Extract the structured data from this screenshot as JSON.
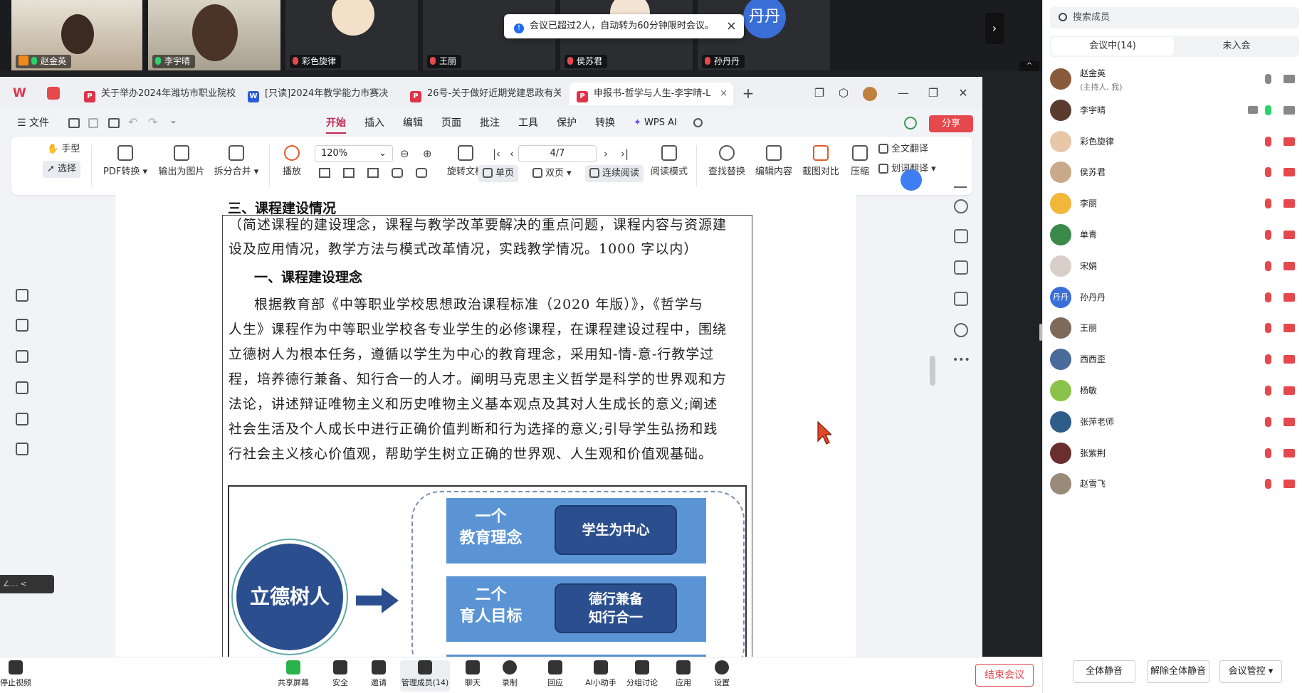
{
  "video_strip": {
    "tiles": [
      {
        "name": "赵金英",
        "mic": "on",
        "host": true
      },
      {
        "name": "李宇晴",
        "mic": "on",
        "host": false
      },
      {
        "name": "彩色旋律",
        "mic": "off",
        "host": false
      },
      {
        "name": "王丽",
        "mic": "off",
        "host": false
      },
      {
        "name": "侯苏君",
        "mic": "off",
        "host": false
      },
      {
        "name": "孙丹丹",
        "mic": "off",
        "host": false,
        "avatar_text": "丹丹"
      }
    ],
    "toast": "会议已超过2人，自动转为60分钟限时会议。",
    "toast_close": "×",
    "next_glyph": "›",
    "collapse_glyph": "^"
  },
  "wps": {
    "logo": "W",
    "tabs": [
      {
        "label": "关于举办2024年潍坊市职业院校",
        "icon": "P",
        "color": "#e0334a"
      },
      {
        "label": "[只读]2024年教学能力市赛决",
        "icon": "W",
        "color": "#2a5bd7"
      },
      {
        "label": "26号-关于做好近期党建思政有关",
        "icon": "P",
        "color": "#e0334a"
      },
      {
        "label": "申报书-哲学与人生-李宇晴-L",
        "icon": "P",
        "color": "#e0334a"
      }
    ],
    "tab_close": "×",
    "new_tab": "+",
    "menu": {
      "file": "文件",
      "items": [
        "开始",
        "插入",
        "编辑",
        "页面",
        "批注",
        "工具",
        "保护",
        "转换",
        "WPS AI"
      ],
      "active": "开始",
      "share": "分享"
    },
    "ribbon": {
      "hand": "手型",
      "select": "选择",
      "pdf_convert": "PDF转换",
      "export_image": "输出为图片",
      "split_merge": "拆分合并",
      "play": "播放",
      "zoom": "120%",
      "rotate": "旋转文档",
      "single": "单页",
      "double": "双页",
      "continuous": "连续阅读",
      "read_mode": "阅读模式",
      "page": "4/7",
      "find_replace": "查找替换",
      "edit_content": "编辑内容",
      "compare": "截图对比",
      "compress": "压缩",
      "full_translate": "全文翻译",
      "word_translate": "划词翻译"
    },
    "doc": {
      "heading": "三、课程建设情况",
      "intro_lines": [
        "（简述课程的建设理念，课程与教学改革要解决的重点问题，课程内容与资源建",
        "设及应用情况，教学方法与模式改革情况，实践教学情况。1000 字以内）"
      ],
      "subhead": "一、课程建设理念",
      "body_lines": [
        "根据教育部《中等职业学校思想政治课程标准（2020 年版）》，《哲学与",
        "人生》课程作为中等职业学校各专业学生的必修课程，在课程建设过程中，围绕",
        "立德树人为根本任务，遵循以学生为中心的教育理念，采用知-情-意-行教学过",
        "程，培养德行兼备、知行合一的人才。阐明马克思主义哲学是科学的世界观和方",
        "法论，讲述辩证唯物主义和历史唯物主义基本观点及其对人生成长的意义;阐述",
        "社会生活及个人成长中进行正确价值判断和行为选择的意义;引导学生弘扬和践",
        "行社会主义核心价值观，帮助学生树立正确的世界观、人生观和价值观基础。"
      ],
      "diagram": {
        "circle": "立德树人",
        "bars": [
          {
            "label": "一个\n教育理念",
            "pill": "学生为中心"
          },
          {
            "label": "二个\n育人目标",
            "pill": "德行兼备\n知行合一"
          }
        ]
      }
    },
    "left_collapse": "<"
  },
  "bottom_bar": {
    "items": [
      "停止视频",
      "共享屏幕",
      "安全",
      "邀请",
      "管理成员(14)",
      "聊天",
      "录制",
      "回应",
      "AI小助手",
      "分组讨论",
      "应用",
      "设置"
    ],
    "end": "结束会议"
  },
  "members": {
    "search_placeholder": "搜索成员",
    "tab_in": "会议中(14)",
    "tab_out": "未入会",
    "list": [
      {
        "name": "赵金英",
        "sub": "(主持人, 我)",
        "mic": "gray",
        "cam": "gray",
        "color": "#8a5a3c"
      },
      {
        "name": "李宇晴",
        "sub": "",
        "mic": "green",
        "cam": "gray",
        "share": true,
        "color": "#5a3b2e"
      },
      {
        "name": "彩色旋律",
        "sub": "",
        "mic": "red",
        "cam": "red",
        "color": "#e8c7a8"
      },
      {
        "name": "侯苏君",
        "sub": "",
        "mic": "red",
        "cam": "red",
        "color": "#c9a98a"
      },
      {
        "name": "李丽",
        "sub": "",
        "mic": "red",
        "cam": "red",
        "color": "#f2b63a"
      },
      {
        "name": "单青",
        "sub": "",
        "mic": "red",
        "cam": "red",
        "color": "#3c8a4a"
      },
      {
        "name": "宋娟",
        "sub": "",
        "mic": "red",
        "cam": "red",
        "color": "#d9cfc8"
      },
      {
        "name": "孙丹丹",
        "sub": "",
        "mic": "red",
        "cam": "red",
        "color": "#3a6fd8",
        "avatar_text": "丹丹"
      },
      {
        "name": "王丽",
        "sub": "",
        "mic": "red",
        "cam": "red",
        "color": "#7d6a5a"
      },
      {
        "name": "西西歪",
        "sub": "",
        "mic": "red",
        "cam": "red",
        "color": "#4a6a9a"
      },
      {
        "name": "杨敏",
        "sub": "",
        "mic": "red",
        "cam": "red",
        "color": "#8bc34a"
      },
      {
        "name": "张萍老师",
        "sub": "",
        "mic": "red",
        "cam": "red",
        "color": "#2e5d8a"
      },
      {
        "name": "张紫荆",
        "sub": "",
        "mic": "red",
        "cam": "red",
        "color": "#6a2e2e"
      },
      {
        "name": "赵雪飞",
        "sub": "",
        "mic": "red",
        "cam": "red",
        "color": "#9a8a7a"
      }
    ],
    "mute_all": "全体静音",
    "unmute_all": "解除全体静音",
    "meeting_control": "会议管控"
  }
}
